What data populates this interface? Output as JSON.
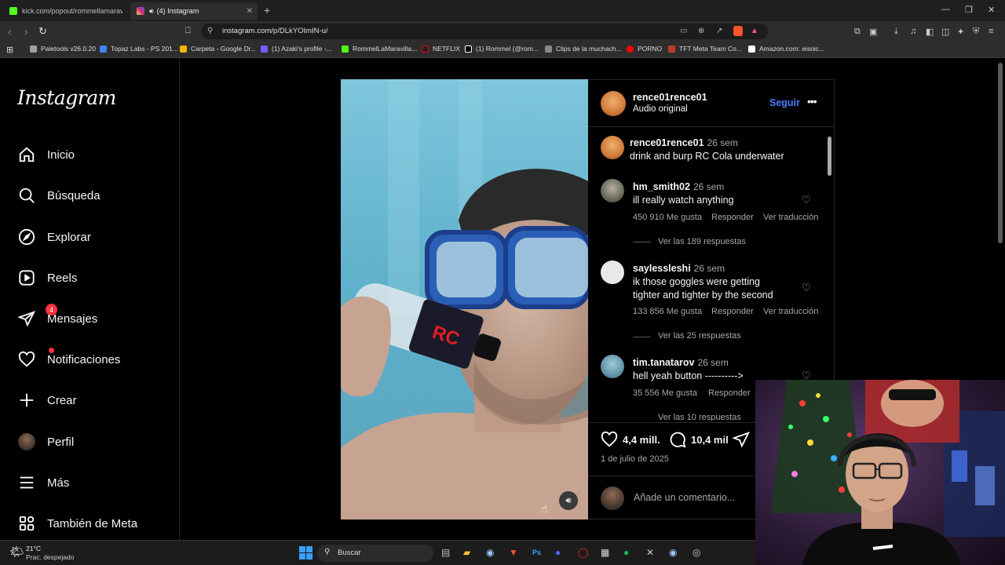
{
  "tabs": [
    {
      "label": "kick.com/popout/rommellamaravilla",
      "active": false
    },
    {
      "label": "(4) Instagram",
      "active": true
    }
  ],
  "address_bar": {
    "url": "instagram.com/p/DLkYOImIN-u/"
  },
  "bookmarks": [
    {
      "label": "Paletools v26.0.20",
      "color": "#9aa0a6"
    },
    {
      "label": "Topaz Labs - PS 201...",
      "color": "#4285f4"
    },
    {
      "label": "Carpeta - Google Dr...",
      "color": "#f4b400"
    },
    {
      "label": "(1) Azaki's profile -...",
      "color": "#7b5cff"
    },
    {
      "label": "RommelLaMaravilla...",
      "color": "#53fc18"
    },
    {
      "label": "NETFLIX",
      "color": "#e50914"
    },
    {
      "label": "(1) Rommel (@rom...",
      "color": "#ffffff"
    },
    {
      "label": "Clips de la muchach...",
      "color": "#888888"
    },
    {
      "label": "PORNO",
      "color": "#ff0000"
    },
    {
      "label": "TFT Meta Team Co...",
      "color": "#c0392b"
    },
    {
      "label": "Amazon.com: eisoic...",
      "color": "#ffffff"
    }
  ],
  "sidebar": {
    "logo": "Instagram",
    "items": [
      {
        "label": "Inicio",
        "icon": "home-icon"
      },
      {
        "label": "Búsqueda",
        "icon": "search-icon"
      },
      {
        "label": "Explorar",
        "icon": "compass-icon"
      },
      {
        "label": "Reels",
        "icon": "reels-icon"
      },
      {
        "label": "Mensajes",
        "icon": "messenger-icon",
        "badge": "4"
      },
      {
        "label": "Notificaciones",
        "icon": "heart-icon"
      },
      {
        "label": "Crear",
        "icon": "plus-icon"
      },
      {
        "label": "Perfil",
        "icon": "avatar"
      },
      {
        "label": "Más",
        "icon": "menu-icon"
      },
      {
        "label": "También de Meta",
        "icon": "meta-grid-icon"
      }
    ]
  },
  "post": {
    "author": "rence01rence01",
    "subtitle": "Audio original",
    "follow_label": "Seguir",
    "caption": {
      "user": "rence01rence01",
      "time": "26 sem",
      "text": "drink and burp RC Cola underwater"
    },
    "comments": [
      {
        "user": "hm_smith02",
        "time": "26 sem",
        "lines": [
          "ill really watch anything"
        ],
        "likes": "450 910 Me gusta",
        "reply": "Responder",
        "translate": "Ver traducción",
        "replies": "Ver las 189 respuestas"
      },
      {
        "user": "saylessleshi",
        "time": "26 sem",
        "lines": [
          "ik those goggles were getting",
          "tighter and tighter by the second"
        ],
        "likes": "133 856 Me gusta",
        "reply": "Responder",
        "translate": "Ver traducción",
        "replies": "Ver las 25 respuestas"
      },
      {
        "user": "tim.tanatarov",
        "time": "26 sem",
        "lines": [
          "hell yeah button ---------->"
        ],
        "likes": "35 556 Me gusta",
        "reply": "Responder",
        "translate": "",
        "replies": "Ver las 10 respuestas"
      }
    ],
    "like_count": "4,4 mill.",
    "comment_count": "10,4 mil",
    "date": "1 de julio de 2025",
    "comment_placeholder": "Añade un comentario..."
  },
  "taskbar": {
    "weather_temp": "21°C",
    "weather_desc": "Prac. despejado",
    "search_label": "Buscar"
  }
}
